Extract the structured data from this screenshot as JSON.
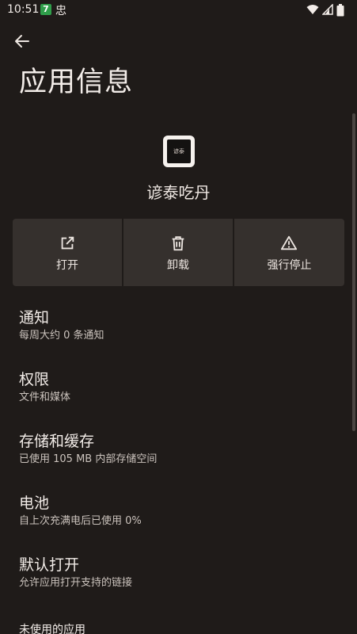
{
  "status_bar": {
    "time": "10:51",
    "badge": "7",
    "notif_char": "忠"
  },
  "header": {
    "title": "应用信息"
  },
  "app": {
    "name": "谚泰吃丹",
    "icon_text": "谚泰"
  },
  "actions": {
    "open": "打开",
    "uninstall": "卸载",
    "force_stop": "强行停止"
  },
  "settings": [
    {
      "title": "通知",
      "subtitle": "每周大约 0 条通知"
    },
    {
      "title": "权限",
      "subtitle": "文件和媒体"
    },
    {
      "title": "存储和缓存",
      "subtitle": "已使用 105 MB 内部存储空间"
    },
    {
      "title": "电池",
      "subtitle": "自上次充满电后已使用 0%"
    },
    {
      "title": "默认打开",
      "subtitle": "允许应用打开支持的链接"
    }
  ],
  "partial_item": "未使用的应用",
  "colors": {
    "background": "#1f1b19",
    "button_bg": "#35302d",
    "text_primary": "#f3ede9",
    "text_secondary": "#cbc3bd"
  }
}
